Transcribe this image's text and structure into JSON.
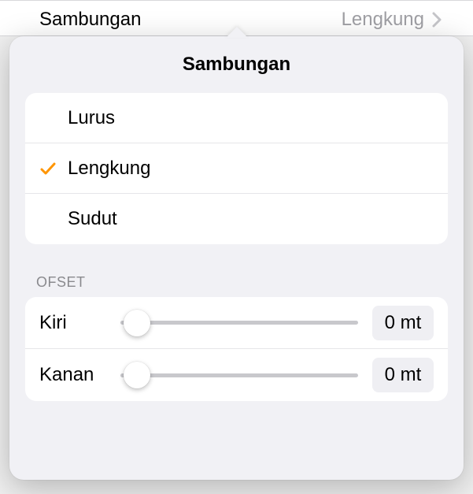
{
  "header": {
    "label": "Sambungan",
    "value": "Lengkung"
  },
  "popover": {
    "title": "Sambungan",
    "options": [
      {
        "label": "Lurus",
        "selected": false
      },
      {
        "label": "Lengkung",
        "selected": true
      },
      {
        "label": "Sudut",
        "selected": false
      }
    ],
    "offset": {
      "header": "OFSET",
      "left": {
        "label": "Kiri",
        "value": "0 mt",
        "position": 0
      },
      "right": {
        "label": "Kanan",
        "value": "0 mt",
        "position": 0
      }
    }
  },
  "colors": {
    "accent": "#ff9500"
  }
}
